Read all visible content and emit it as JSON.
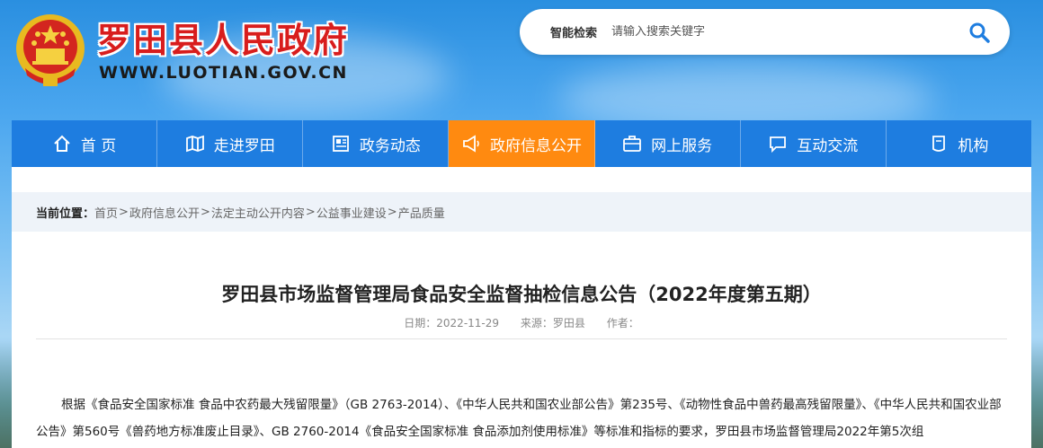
{
  "header": {
    "site_title": "罗田县人民政府",
    "site_url": "WWW.LUOTIAN.GOV.CN"
  },
  "search": {
    "label": "智能检索",
    "placeholder": "请输入搜索关键字"
  },
  "nav": {
    "items": [
      {
        "label": "首 页",
        "icon": "home-icon"
      },
      {
        "label": "走进罗田",
        "icon": "map-icon"
      },
      {
        "label": "政务动态",
        "icon": "news-icon"
      },
      {
        "label": "政府信息公开",
        "icon": "megaphone-icon"
      },
      {
        "label": "网上服务",
        "icon": "briefcase-icon"
      },
      {
        "label": "互动交流",
        "icon": "chat-icon"
      },
      {
        "label": "机构",
        "icon": "building-icon"
      }
    ],
    "active_index": 3
  },
  "breadcrumb": {
    "label": "当前位置：",
    "items": [
      "首页",
      "政府信息公开",
      "法定主动公开内容",
      "公益事业建设",
      "产品质量"
    ],
    "separator": ">"
  },
  "article": {
    "title": "罗田县市场监督管理局食品安全监督抽检信息公告（2022年度第五期）",
    "date": "日期：2022-11-29",
    "source": "来源：罗田县",
    "author": "作者：",
    "body": "根据《食品安全国家标准 食品中农药最大残留限量》（GB 2763-2014）、《中华人民共和国农业部公告》第235号、《动物性食品中兽药最高残留限量》、《中华人民共和国农业部公告》第560号《兽药地方标准废止目录》、GB 2760-2014《食品安全国家标准 食品添加剂使用标准》等标准和指标的要求，罗田县市场监督管理局2022年第5次组"
  },
  "colors": {
    "nav_bg": "#1e7de0",
    "nav_active": "#ff8a10",
    "title_red": "#d81d1d"
  }
}
